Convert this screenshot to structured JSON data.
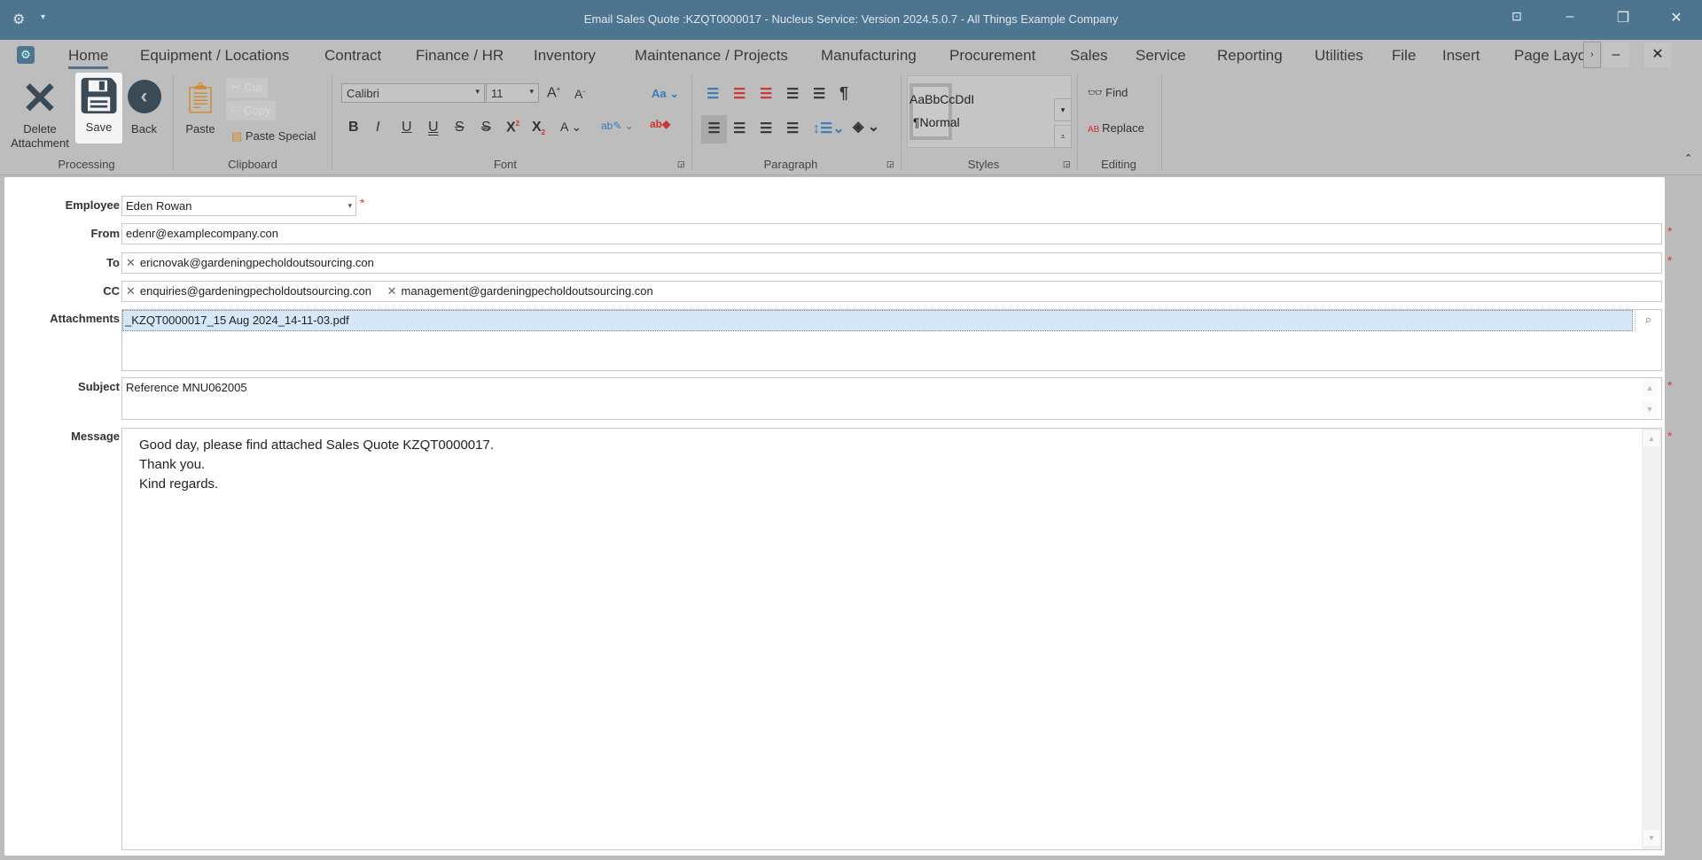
{
  "window": {
    "title": "Email Sales Quote :KZQT0000017 - Nucleus Service: Version 2024.5.0.7 - All Things Example Company"
  },
  "menu": {
    "tabs": [
      "Home",
      "Equipment / Locations",
      "Contract",
      "Finance / HR",
      "Inventory",
      "Maintenance / Projects",
      "Manufacturing",
      "Procurement",
      "Sales",
      "Service",
      "Reporting",
      "Utilities",
      "File",
      "Insert",
      "Page Layo"
    ]
  },
  "ribbon": {
    "processing": {
      "label": "Processing",
      "delete": "Delete Attachment",
      "save": "Save",
      "back": "Back"
    },
    "clipboard": {
      "label": "Clipboard",
      "paste": "Paste",
      "cut": "Cut",
      "copy": "Copy",
      "paste_special": "Paste Special"
    },
    "font": {
      "label": "Font",
      "family": "Calibri",
      "size": "11"
    },
    "paragraph": {
      "label": "Paragraph"
    },
    "styles": {
      "label": "Styles",
      "preview": "AaBbCcDdI",
      "normal": "¶Normal"
    },
    "editing": {
      "label": "Editing",
      "find": "Find",
      "replace": "Replace"
    }
  },
  "form": {
    "employee": {
      "label": "Employee",
      "value": "Eden Rowan"
    },
    "from": {
      "label": "From",
      "value": "edenr@examplecompany.con"
    },
    "to": {
      "label": "To",
      "recipients": [
        "ericnovak@gardeningpecholdoutsourcing.con"
      ]
    },
    "cc": {
      "label": "CC",
      "recipients": [
        "enquiries@gardeningpecholdoutsourcing.con",
        "management@gardeningpecholdoutsourcing.con"
      ]
    },
    "attachments": {
      "label": "Attachments",
      "files": [
        "_KZQT0000017_15 Aug 2024_14-11-03.pdf"
      ]
    },
    "subject": {
      "label": "Subject",
      "value": "Reference MNU062005"
    },
    "message": {
      "label": "Message",
      "lines": [
        "Good day, please find attached Sales Quote KZQT0000017.",
        "Thank you.",
        "Kind regards."
      ]
    },
    "required_mark": "*"
  },
  "colors": {
    "titlebar": "#4e7590",
    "required": "#e53535",
    "selection": "#d6e8f7"
  }
}
